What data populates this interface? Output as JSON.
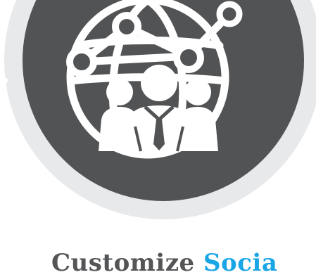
{
  "hero": {
    "icon": "global-network-people-icon",
    "outer_ring_color": "#e8e9eb",
    "disc_color": "#525355",
    "icon_color": "#ffffff"
  },
  "headline": {
    "text_primary": "Customize",
    "text_accent": "Socia",
    "primary_color": "#545557",
    "accent_color": "#1aa6e6"
  }
}
